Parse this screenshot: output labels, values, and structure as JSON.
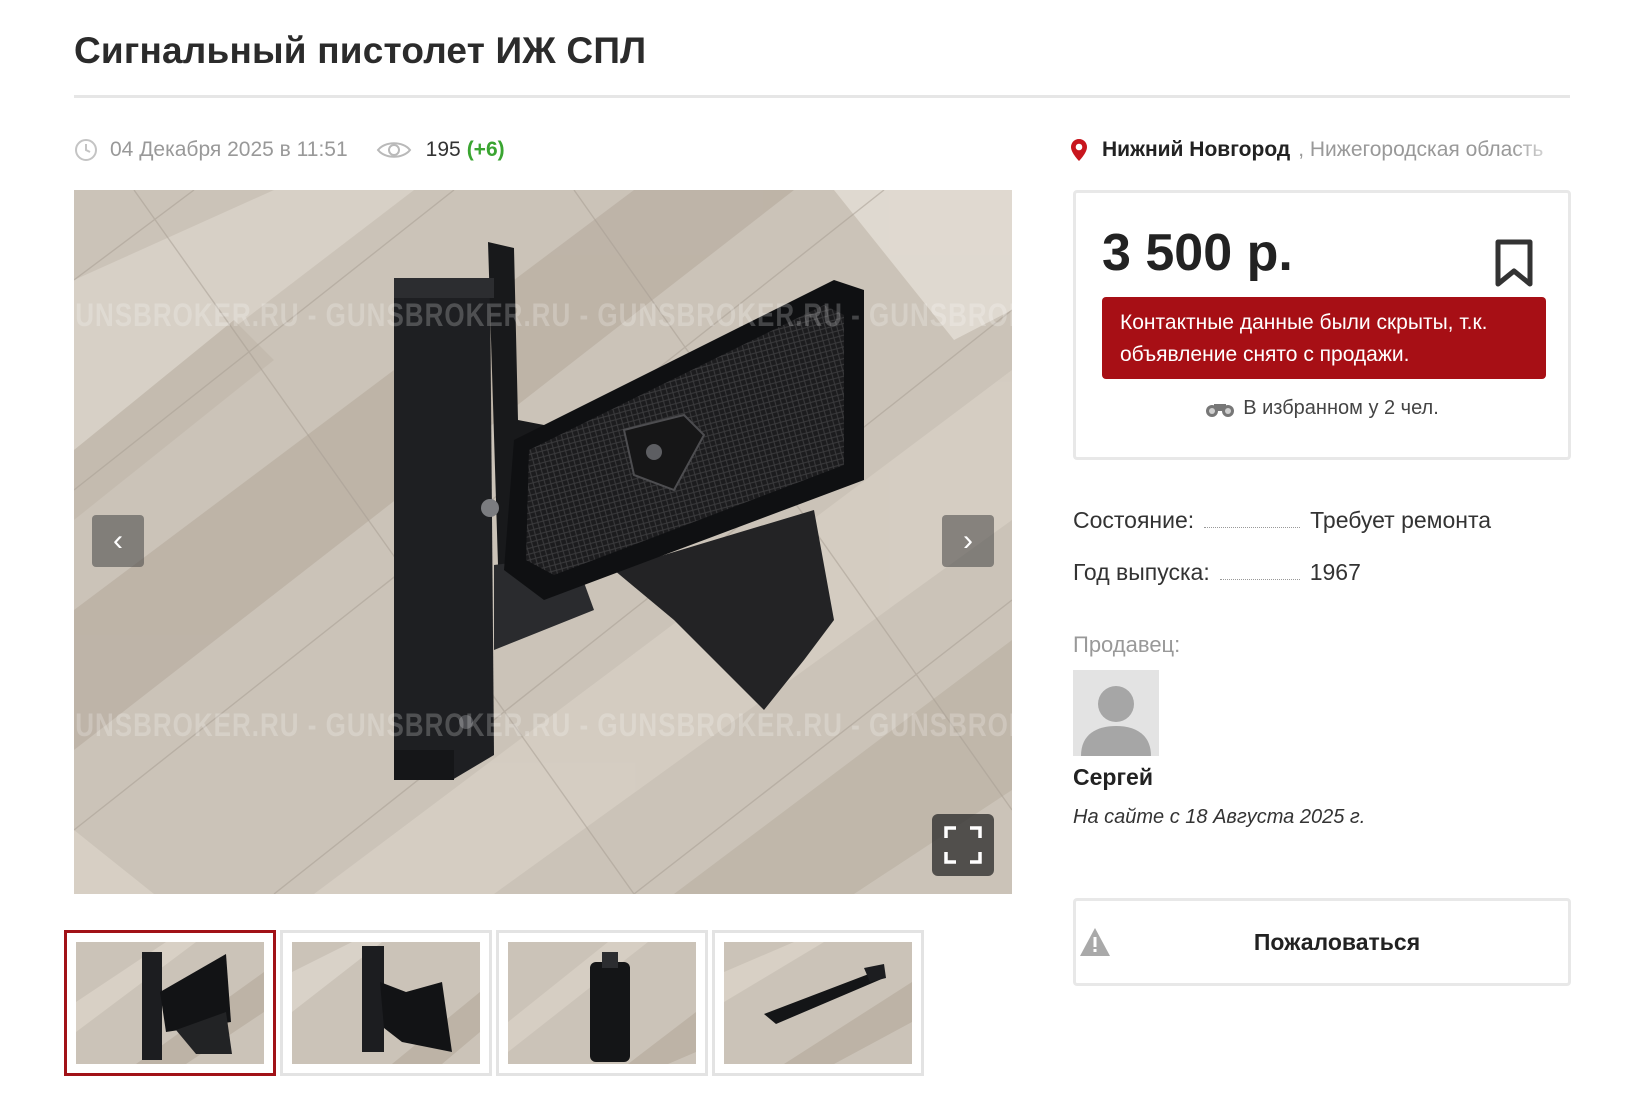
{
  "listing": {
    "title": "Сигнальный пистолет ИЖ СПЛ",
    "date": "04 Декабря 2025 в 11:51",
    "views": "195",
    "views_delta": "(+6)",
    "location_city": "Нижний Новгород",
    "location_region": ", Нижегородская область"
  },
  "gallery": {
    "watermark": "GUNSBROKER.RU - GUNSBROKER.RU - GUNSBROKER.RU - GUNSBROKER.RU - GUNSBROKER.RU",
    "prev_icon": "chevron-left-icon",
    "next_icon": "chevron-right-icon",
    "fullscreen_icon": "fullscreen-icon",
    "prev_glyph": "‹",
    "next_glyph": "›",
    "thumbnail_count": 4,
    "active_thumbnail": 1
  },
  "price_card": {
    "price": "3 500 р.",
    "bookmark_icon": "bookmark-icon",
    "hidden_note": "Контактные данные были скрыты, т.к. объявление снято с продажи.",
    "favorites_text": "В избранном у 2 чел.",
    "favorites_icon": "binoculars-icon"
  },
  "params": {
    "condition_label": "Состояние:",
    "condition_value": "Требует ремонта",
    "year_label": "Год выпуска:",
    "year_value": "1967"
  },
  "seller": {
    "label": "Продавец:",
    "name": "Сергей",
    "since": "На сайте с 18 Августа 2025 г.",
    "avatar_icon": "avatar-placeholder-icon"
  },
  "actions": {
    "complain_label": "Пожаловаться",
    "complain_icon": "warning-icon"
  },
  "colors": {
    "accent_red": "#a70f15",
    "active_thumb_border": "#a11217",
    "views_delta_green": "#3aa531"
  }
}
